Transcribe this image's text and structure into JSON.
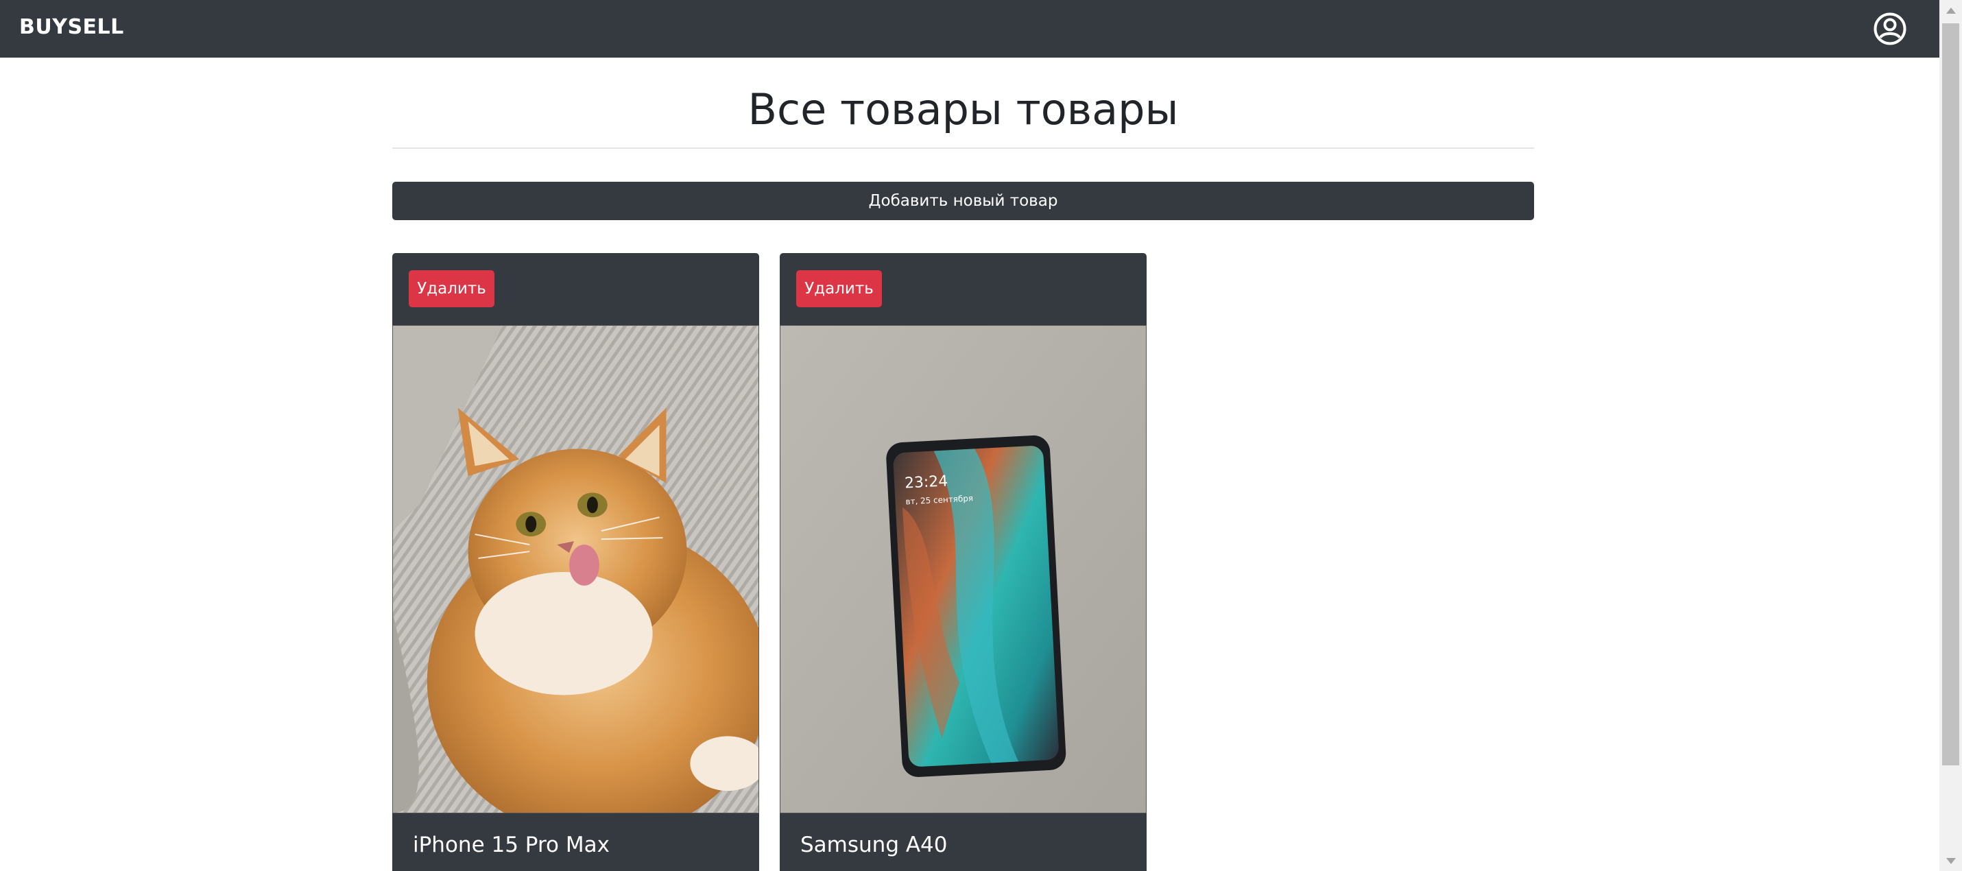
{
  "navbar": {
    "brand": "BUYSELL",
    "user_icon": "user-circle-icon"
  },
  "main": {
    "title": "Все товары товары",
    "add_button_label": "Добавить новый товар"
  },
  "products": [
    {
      "delete_label": "Удалить",
      "title": "iPhone 15 Pro Max",
      "image_subject": "ginger-cat-photo"
    },
    {
      "delete_label": "Удалить",
      "title": "Samsung A40",
      "image_subject": "smartphone-photo"
    }
  ],
  "colors": {
    "navbar_bg": "#343a40",
    "danger": "#dc3545",
    "card_bg": "#343a40"
  }
}
